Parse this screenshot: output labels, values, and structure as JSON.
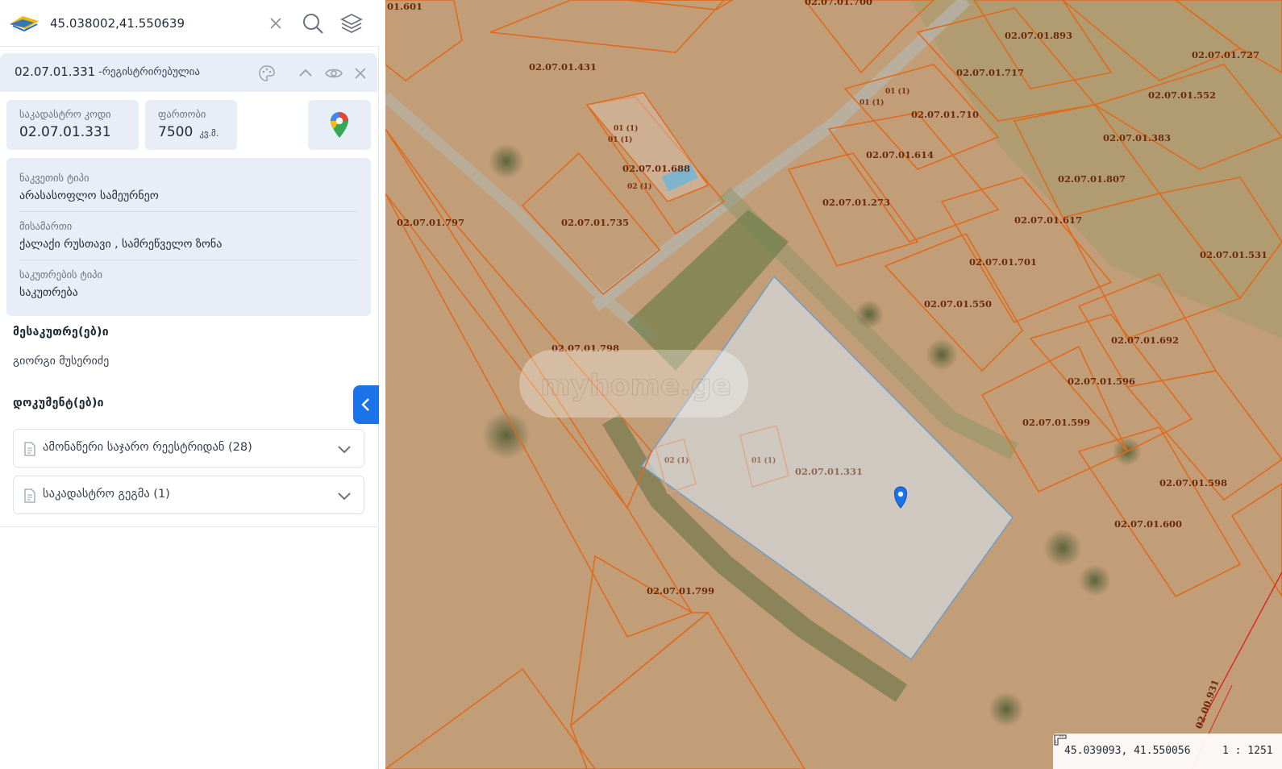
{
  "search": {
    "value": "45.038002,41.550639"
  },
  "panel": {
    "code": "02.07.01.331",
    "status": "-რეგისტრირებულია"
  },
  "cards": {
    "cadastral_label": "საკადასტრო კოდი",
    "cadastral_value": "02.07.01.331",
    "area_label": "ფართობი",
    "area_value": "7500",
    "area_unit": "კვ.მ."
  },
  "details": [
    {
      "label": "ნაკვეთის ტიპი",
      "value": "არასასოფლო სამეურნეო"
    },
    {
      "label": "მისამართი",
      "value": "ქალაქი რუსთავი , სამრეწველო ზონა"
    },
    {
      "label": "საკუთრების ტიპი",
      "value": "საკუთრება"
    }
  ],
  "owners": {
    "title": "მესაკუთრე(ებ)ი",
    "name": "გიორგი მუსერიძე"
  },
  "documents": {
    "title": "დოკუმენტ(ებ)ი",
    "items": [
      {
        "label": "ამონაწერი საჯარო რეესტრიდან (28)"
      },
      {
        "label": "საკადასტრო გეგმა (1)"
      }
    ]
  },
  "map": {
    "watermark": "myhome.ge",
    "coordinates": "45.039093, 41.550056",
    "scale": "1 : 1251",
    "selected_parcel": "02.07.01.331",
    "parcel_labels": [
      "01.601",
      "02.07.01.700",
      "02.07.01.431",
      "02.07.01.893",
      "02.07.01.727",
      "02.07.01.717",
      "02.07.01.552",
      "02.07.01.710",
      "02.07.01.383",
      "02.07.01.614",
      "02.07.01.688",
      "02.07.01.807",
      "02.07.01.273",
      "02.07.01.735",
      "02.07.01.797",
      "02.07.01.617",
      "02.07.01.531",
      "02.07.01.701",
      "02.07.01.550",
      "02.07.01.692",
      "02.07.01.798",
      "02.07.01.596",
      "02.07.01.599",
      "02.07.01.598",
      "02.07.01.600",
      "02.07.01.799",
      "02.00.931",
      "02.07.01.331"
    ],
    "building_labels": [
      "01 (1)",
      "01 (1)",
      "02 (1)",
      "01 (1)",
      "01 (1)",
      "02 (1)",
      "01 (1)",
      "02"
    ]
  },
  "colors": {
    "accent": "#1a73e8",
    "parcel_outline": "#e06a1c",
    "selected_fill": "#cfd6dc",
    "panel_bg": "#e8eef8"
  }
}
